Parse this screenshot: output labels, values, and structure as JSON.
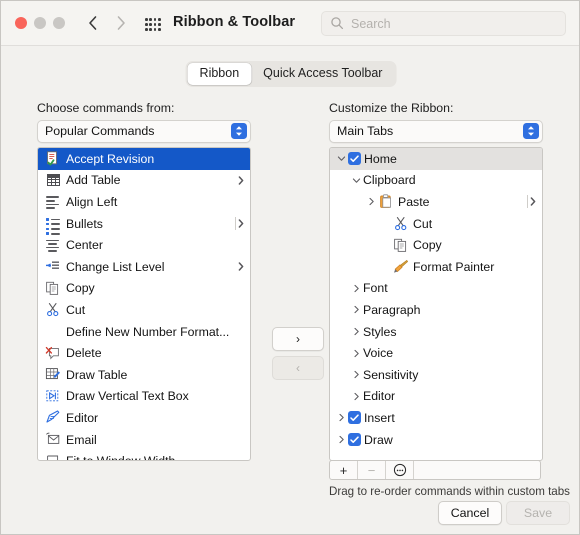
{
  "window": {
    "title": "Ribbon & Toolbar",
    "traffic_lights": [
      "close",
      "minimize",
      "zoom"
    ],
    "nav": {
      "back": "back-arrow",
      "forward": "forward-arrow"
    },
    "grid_button": "all-preferences-grid",
    "search": {
      "placeholder": "Search",
      "value": "",
      "icon": "search-icon"
    }
  },
  "tabs": {
    "items": [
      {
        "label": "Ribbon",
        "selected": true
      },
      {
        "label": "Quick Access Toolbar",
        "selected": false
      }
    ]
  },
  "left_panel": {
    "label": "Choose commands from:",
    "popup_value": "Popular Commands",
    "commands": [
      {
        "label": "Accept Revision",
        "icon": "accept-revision-icon",
        "selected": true,
        "submenu": false
      },
      {
        "label": "Add Table",
        "icon": "table-grid-icon",
        "selected": false,
        "submenu": true
      },
      {
        "label": "Align Left",
        "icon": "align-left-icon",
        "selected": false,
        "submenu": false
      },
      {
        "label": "Bullets",
        "icon": "bullets-icon",
        "selected": false,
        "submenu": true,
        "divider": true
      },
      {
        "label": "Center",
        "icon": "align-center-icon",
        "selected": false,
        "submenu": false
      },
      {
        "label": "Change List Level",
        "icon": "change-list-level-icon",
        "selected": false,
        "submenu": true
      },
      {
        "label": "Copy",
        "icon": "copy-icon",
        "selected": false,
        "submenu": false
      },
      {
        "label": "Cut",
        "icon": "scissors-icon",
        "selected": false,
        "submenu": false
      },
      {
        "label": "Define New Number Format...",
        "icon": "none",
        "selected": false,
        "submenu": false
      },
      {
        "label": "Delete",
        "icon": "delete-comment-icon",
        "selected": false,
        "submenu": false
      },
      {
        "label": "Draw Table",
        "icon": "draw-table-icon",
        "selected": false,
        "submenu": false
      },
      {
        "label": "Draw Vertical Text Box",
        "icon": "vertical-text-box-icon",
        "selected": false,
        "submenu": false
      },
      {
        "label": "Editor",
        "icon": "editor-pen-icon",
        "selected": false,
        "submenu": false
      },
      {
        "label": "Email",
        "icon": "email-icon",
        "selected": false,
        "submenu": false
      },
      {
        "label": "Fit to Window Width",
        "icon": "fit-window-width-icon",
        "selected": false,
        "submenu": false
      }
    ]
  },
  "transfer": {
    "add_label": "›",
    "add_icon": "chevron-right-icon",
    "add_enabled": true,
    "remove_label": "‹",
    "remove_icon": "chevron-left-icon",
    "remove_enabled": false
  },
  "right_panel": {
    "label": "Customize the Ribbon:",
    "popup_value": "Main Tabs",
    "tree": [
      {
        "label": "Home",
        "indent": 0,
        "disclosure": "expanded",
        "checkbox": true,
        "highlighted": true,
        "icon": "none"
      },
      {
        "label": "Clipboard",
        "indent": 1,
        "disclosure": "expanded",
        "checkbox": false,
        "icon": "none"
      },
      {
        "label": "Paste",
        "indent": 2,
        "disclosure": "collapsed",
        "checkbox": false,
        "icon": "paste-icon",
        "tail_arrow": true,
        "divider": true
      },
      {
        "label": "Cut",
        "indent": 3,
        "disclosure": "none",
        "checkbox": false,
        "icon": "scissors-icon"
      },
      {
        "label": "Copy",
        "indent": 3,
        "disclosure": "none",
        "checkbox": false,
        "icon": "copy-icon"
      },
      {
        "label": "Format Painter",
        "indent": 3,
        "disclosure": "none",
        "checkbox": false,
        "icon": "format-painter-icon"
      },
      {
        "label": "Font",
        "indent": 1,
        "disclosure": "collapsed",
        "checkbox": false,
        "icon": "none"
      },
      {
        "label": "Paragraph",
        "indent": 1,
        "disclosure": "collapsed",
        "checkbox": false,
        "icon": "none"
      },
      {
        "label": "Styles",
        "indent": 1,
        "disclosure": "collapsed",
        "checkbox": false,
        "icon": "none"
      },
      {
        "label": "Voice",
        "indent": 1,
        "disclosure": "collapsed",
        "checkbox": false,
        "icon": "none"
      },
      {
        "label": "Sensitivity",
        "indent": 1,
        "disclosure": "collapsed",
        "checkbox": false,
        "icon": "none"
      },
      {
        "label": "Editor",
        "indent": 1,
        "disclosure": "collapsed",
        "checkbox": false,
        "icon": "none"
      },
      {
        "label": "Insert",
        "indent": 0,
        "disclosure": "collapsed",
        "checkbox": true,
        "icon": "none"
      },
      {
        "label": "Draw",
        "indent": 0,
        "disclosure": "collapsed",
        "checkbox": true,
        "icon": "none"
      }
    ],
    "toolbar": [
      {
        "label": "+",
        "icon": "plus-icon",
        "enabled": true
      },
      {
        "label": "−",
        "icon": "minus-icon",
        "enabled": false
      },
      {
        "label": "⋯",
        "icon": "settings-ellipsis-icon",
        "enabled": true
      }
    ],
    "hint": "Drag to re-order commands within custom tabs"
  },
  "footer": {
    "cancel_label": "Cancel",
    "save_label": "Save",
    "save_enabled": false
  },
  "colors": {
    "selection_blue": "#1458c8",
    "accent_blue": "#2f6fe0",
    "window_bg": "#f2f1ee",
    "titlebar_bg": "#f5f4f1",
    "row_highlight": "#e3e1df",
    "close_red": "#f9655b"
  }
}
